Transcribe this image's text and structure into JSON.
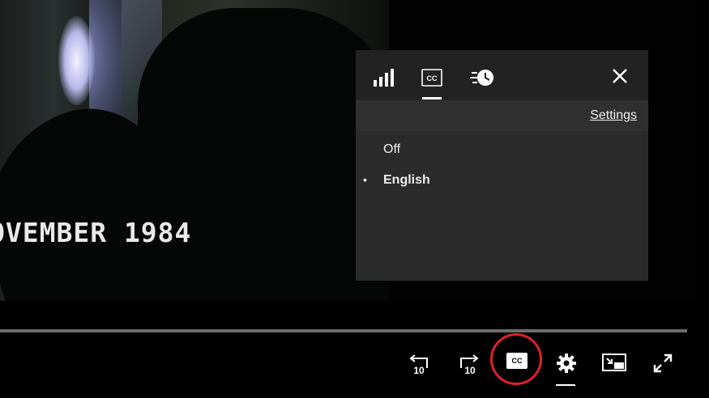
{
  "video": {
    "caption_text": "OVEMBER 1984",
    "progress": 1.0
  },
  "caption_menu": {
    "tabs": [
      {
        "icon": "signal-bars-icon"
      },
      {
        "icon": "cc-icon",
        "selected": true
      },
      {
        "icon": "speed-clock-icon"
      }
    ],
    "close_icon": "close-icon",
    "settings_link": "Settings",
    "options": [
      {
        "label": "Off",
        "selected": false,
        "bullet": ""
      },
      {
        "label": "English",
        "selected": true,
        "bullet": "•"
      }
    ]
  },
  "controls": {
    "rewind_label": "10",
    "forward_label": "10",
    "cc_label": "CC",
    "highlight_color": "#e0202a"
  }
}
